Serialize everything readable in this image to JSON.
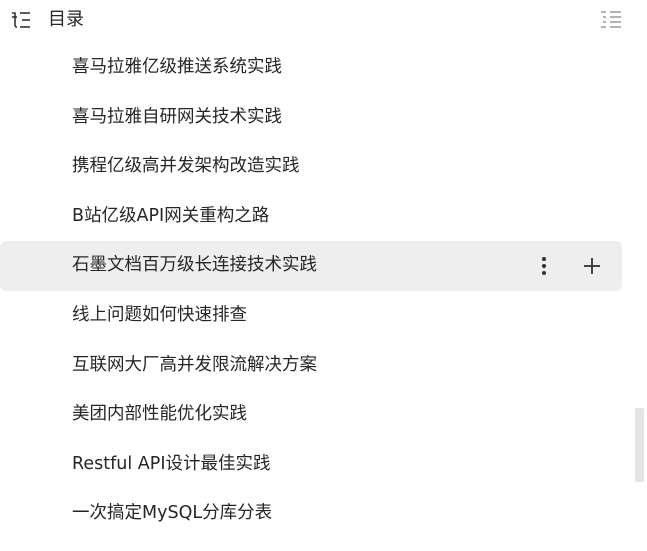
{
  "header": {
    "title": "目录",
    "toc_icon": "toc-list-icon",
    "collapse_icon": "collapse-list-icon"
  },
  "items": [
    {
      "label": "喜马拉雅亿级推送系统实践"
    },
    {
      "label": "喜马拉雅自研网关技术实践"
    },
    {
      "label": "携程亿级高并发架构改造实践"
    },
    {
      "label": "B站亿级API网关重构之路"
    },
    {
      "label": "石墨文档百万级长连接技术实践",
      "active": true
    },
    {
      "label": "线上问题如何快速排查"
    },
    {
      "label": "互联网大厂高并发限流解决方案"
    },
    {
      "label": "美团内部性能优化实践"
    },
    {
      "label": "Restful API设计最佳实践"
    },
    {
      "label": "一次搞定MySQL分库分表"
    }
  ],
  "item_actions": {
    "more_icon": "more-vertical-icon",
    "add_icon": "plus-icon"
  },
  "colors": {
    "text": "#262626",
    "active_bg": "#eeeeee",
    "scroll_thumb": "#e3e3e3"
  }
}
